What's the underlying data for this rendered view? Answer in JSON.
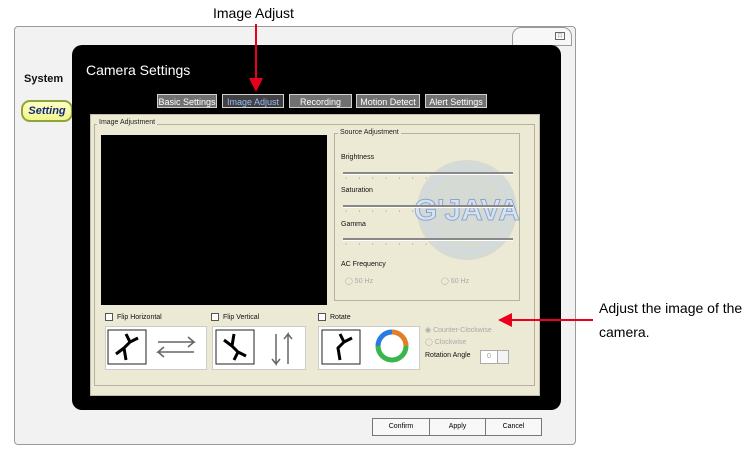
{
  "callouts": {
    "top": "Image Adjust",
    "right_line1": "Adjust the image of the",
    "right_line2": "camera."
  },
  "sidebar": {
    "system_label": "System",
    "setting_label": "Setting"
  },
  "panel": {
    "title": "Camera Settings",
    "tabs": [
      {
        "label": "Basic Settings"
      },
      {
        "label": "Image Adjust"
      },
      {
        "label": "Recording"
      },
      {
        "label": "Motion Detect"
      },
      {
        "label": "Alert Settings"
      }
    ],
    "active_tab": "Image Adjust"
  },
  "image_adjustment": {
    "group_label": "Image Adjustment",
    "source_group_label": "Source Adjustment",
    "sliders": [
      {
        "label": "Brightness"
      },
      {
        "label": "Saturation"
      },
      {
        "label": "Gamma"
      }
    ],
    "ac_frequency_label": "AC Frequency",
    "ac_options": [
      "50 Hz",
      "60 Hz"
    ],
    "watermark": "G'JAVA",
    "flip_horizontal_label": "Flip Horizontal",
    "flip_vertical_label": "Flip Vertical",
    "rotate_label": "Rotate",
    "rotate_options": [
      "Counter-Clockwise",
      "Clockwise"
    ],
    "rotation_angle_label": "Rotation Angle",
    "rotation_angle_value": "0"
  },
  "footer": {
    "confirm": "Confirm",
    "apply": "Apply",
    "cancel": "Cancel"
  },
  "colors": {
    "annotation_arrow": "#e8001c",
    "panel_bg": "#000000",
    "content_bg": "#ece9d4",
    "setting_button": "#f3f58c"
  },
  "icons": {
    "close": "close-icon",
    "flip_horizontal": "horizontal-arrows-icon",
    "flip_vertical": "vertical-arrows-icon",
    "rotate": "rotate-arrows-icon"
  }
}
